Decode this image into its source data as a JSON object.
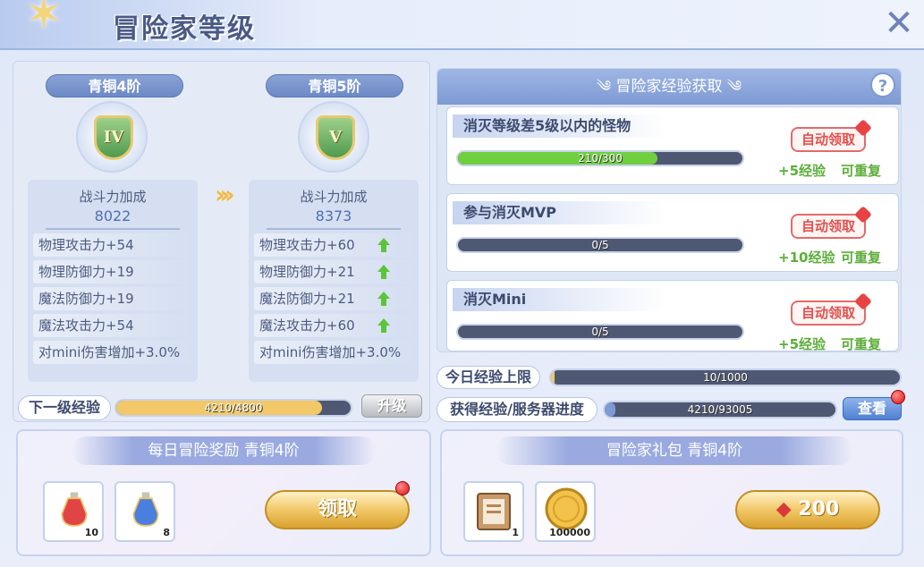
{
  "header": {
    "title": "冒险家等级"
  },
  "current_tier": {
    "name": "青铜4阶",
    "numeral": "IV",
    "stat_title": "战斗力加成",
    "total": "8022",
    "stats": [
      "物理攻击力+54",
      "物理防御力+19",
      "魔法防御力+19",
      "魔法攻击力+54",
      "对mini伤害增加+3.0%"
    ]
  },
  "next_tier": {
    "name": "青铜5阶",
    "numeral": "V",
    "stat_title": "战斗力加成",
    "total": "8373",
    "stats": [
      "物理攻击力+60",
      "物理防御力+21",
      "魔法防御力+21",
      "魔法攻击力+60",
      "对mini伤害增加+3.0%"
    ]
  },
  "next_level_exp": {
    "label": "下一级经验",
    "text": "4210/4800",
    "progress": 0.877
  },
  "upgrade_label": "升级",
  "exp_panel": {
    "title": "冒险家经验获取",
    "quests": [
      {
        "title": "消灭等级差5级以内的怪物",
        "progress_text": "210/300",
        "progress": 0.7,
        "button": "自动领取",
        "reward": "+5经验",
        "repeat": "可重复"
      },
      {
        "title": "参与消灭MVP",
        "progress_text": "0/5",
        "progress": 0,
        "button": "自动领取",
        "reward": "+10经验",
        "repeat": "可重复"
      },
      {
        "title": "消灭Mini",
        "progress_text": "0/5",
        "progress": 0,
        "button": "自动领取",
        "reward": "+5经验",
        "repeat": "可重复"
      }
    ]
  },
  "daily_limit": {
    "label": "今日经验上限",
    "text": "10/1000",
    "progress": 0.01
  },
  "server_progress": {
    "label": "获得经验/服务器进度",
    "text": "4210/93005",
    "progress": 0.045
  },
  "view_label": "查看",
  "daily_reward": {
    "title": "每日冒险奖励 青铜4阶",
    "items": [
      {
        "icon": "red-potion-icon",
        "count": "10"
      },
      {
        "icon": "blue-potion-icon",
        "count": "8"
      }
    ],
    "button": "领取"
  },
  "gift_pack": {
    "title": "冒险家礼包 青铜4阶",
    "items": [
      {
        "icon": "book-icon",
        "count": "1"
      },
      {
        "icon": "gold-coin-icon",
        "count": "100000"
      }
    ],
    "price": "200"
  },
  "colors": {
    "accent": "#7e9ad4",
    "green_fill": "#6fcf3f",
    "gold_fill": "#f2c869",
    "reward_green": "#5cae3a",
    "alert_red": "#e24f4f"
  }
}
